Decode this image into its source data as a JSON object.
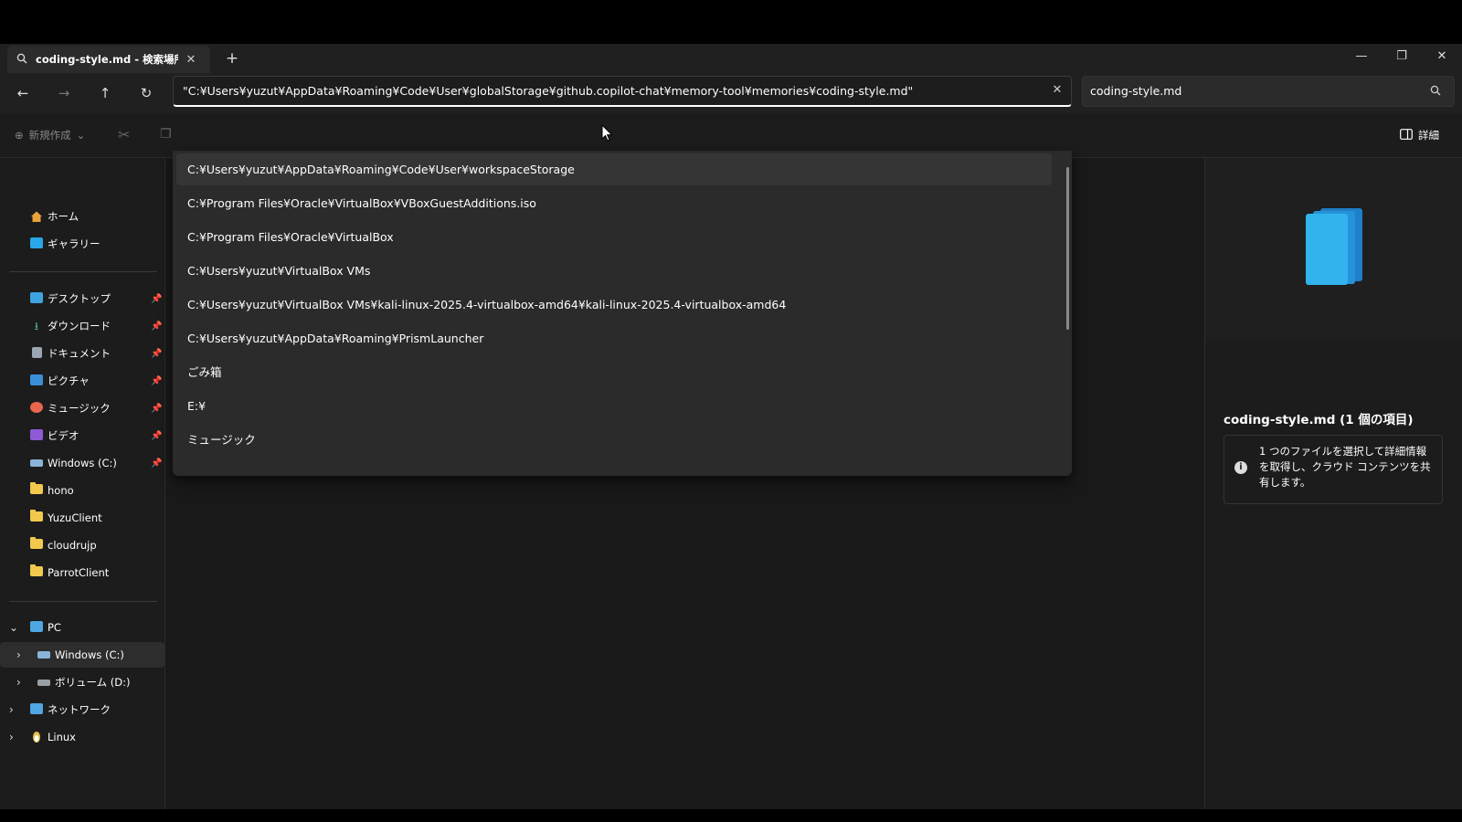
{
  "tab": {
    "title": "coding-style.md - 検索場所: Co",
    "icon": "search-icon"
  },
  "address": {
    "value": "\"C:¥Users¥yuzut¥AppData¥Roaming¥Code¥User¥globalStorage¥github.copilot-chat¥memory-tool¥memories¥coding-style.md\""
  },
  "search": {
    "value": "coding-style.md"
  },
  "commands": {
    "new": "新規作成",
    "details": "詳細"
  },
  "suggestions": [
    "C:¥Users¥yuzut¥AppData¥Roaming¥Code¥User¥workspaceStorage",
    "C:¥Program Files¥Oracle¥VirtualBox¥VBoxGuestAdditions.iso",
    "C:¥Program Files¥Oracle¥VirtualBox",
    "C:¥Users¥yuzut¥VirtualBox VMs",
    "C:¥Users¥yuzut¥VirtualBox VMs¥kali-linux-2025.4-virtualbox-amd64¥kali-linux-2025.4-virtualbox-amd64",
    "C:¥Users¥yuzut¥AppData¥Roaming¥PrismLauncher",
    "ごみ箱",
    "E:¥",
    "ミュージック"
  ],
  "sidebar": {
    "top": [
      "ホーム",
      "ギャラリー"
    ],
    "pinned": [
      "デスクトップ",
      "ダウンロード",
      "ドキュメント",
      "ピクチャ",
      "ミュージック",
      "ビデオ",
      "Windows (C:)"
    ],
    "folders": [
      "hono",
      "YuzuClient",
      "cloudrujp",
      "ParrotClient"
    ],
    "tree": [
      "PC",
      "Windows (C:)",
      "ボリューム (D:)",
      "ネットワーク",
      "Linux"
    ]
  },
  "details": {
    "title": "coding-style.md (1 個の項目)",
    "info": "1 つのファイルを選択して詳細情報を取得し、クラウド コンテンツを共有します。"
  },
  "colors": {
    "accent": "#2aa7e8",
    "folder": "#f2c94c",
    "selected": "#2d2d2d"
  }
}
